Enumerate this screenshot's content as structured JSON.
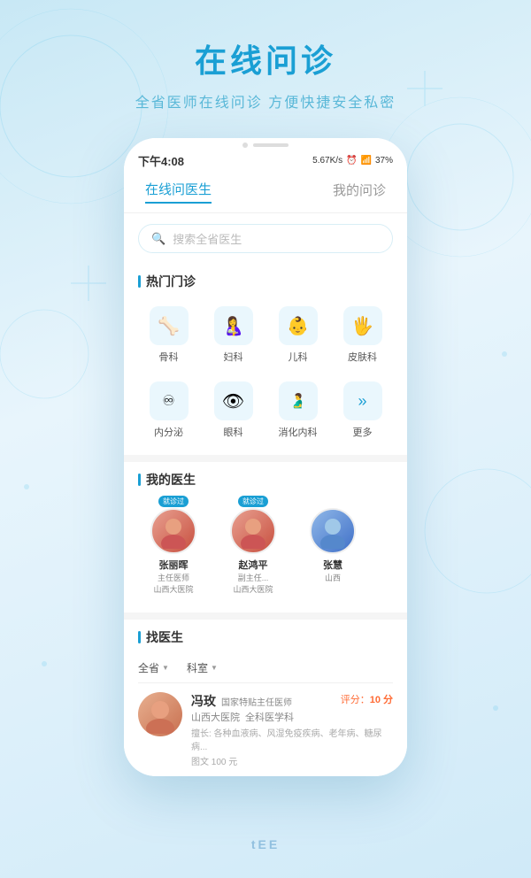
{
  "page": {
    "background_title": "在线问诊",
    "background_subtitle": "全省医师在线问诊 方便快捷安全私密"
  },
  "status_bar": {
    "time": "下午4:08",
    "network": "5.67K/s",
    "battery": "37%"
  },
  "nav": {
    "tab1": "在线问医生",
    "tab2": "我的问诊"
  },
  "search": {
    "placeholder": "搜索全省医生"
  },
  "hot_departments": {
    "title": "热门门诊",
    "items": [
      {
        "name": "骨科",
        "icon": "🦴"
      },
      {
        "name": "妇科",
        "icon": "👶"
      },
      {
        "name": "儿科",
        "icon": "🧒"
      },
      {
        "name": "皮肤科",
        "icon": "👂"
      },
      {
        "name": "内分泌",
        "icon": "🔬"
      },
      {
        "name": "眼科",
        "icon": "👁"
      },
      {
        "name": "消化内科",
        "icon": "🫃"
      },
      {
        "name": "更多",
        "icon": "»"
      }
    ]
  },
  "my_doctors": {
    "title": "我的医生",
    "items": [
      {
        "name": "张丽晖",
        "badge": "就诊过",
        "title": "主任医师",
        "hospital": "山西大医院",
        "gender": "female"
      },
      {
        "name": "赵鸿平",
        "badge": "就诊过",
        "title": "副主任...",
        "hospital": "山西大医院",
        "gender": "female"
      },
      {
        "name": "张慧",
        "badge": "",
        "title": "",
        "hospital": "山西",
        "gender": "male"
      }
    ]
  },
  "find_doctor": {
    "title": "找医生",
    "filter1": "全省",
    "filter2": "科室",
    "doctor": {
      "name": "冯玫",
      "position": "国家特贴主任医师",
      "hospital": "山西大医院",
      "department": "全科医学科",
      "specialty": "擅长: 各种血液病、风湿免疫疾病、老年病、糖尿病...",
      "price": "图文 100 元",
      "rating_label": "评分：",
      "rating_value": "10 分"
    }
  },
  "bottom_text": "tEE"
}
